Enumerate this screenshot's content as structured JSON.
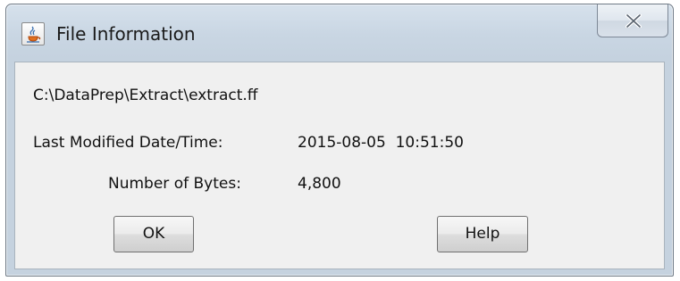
{
  "window": {
    "title": "File Information",
    "icon": "java-cup-icon"
  },
  "file": {
    "path": "C:\\DataPrep\\Extract\\extract.ff",
    "modified_label": "Last Modified Date/Time:",
    "modified_value": "2015-08-05  10:51:50",
    "bytes_label": "Number of Bytes:",
    "bytes_value": "4,800"
  },
  "buttons": {
    "ok_label": "OK",
    "help_label": "Help",
    "close_icon": "close-icon"
  },
  "colors": {
    "titlebar": "#c9d6e3",
    "content_bg": "#f0f0f0",
    "border": "#6f7a86"
  }
}
